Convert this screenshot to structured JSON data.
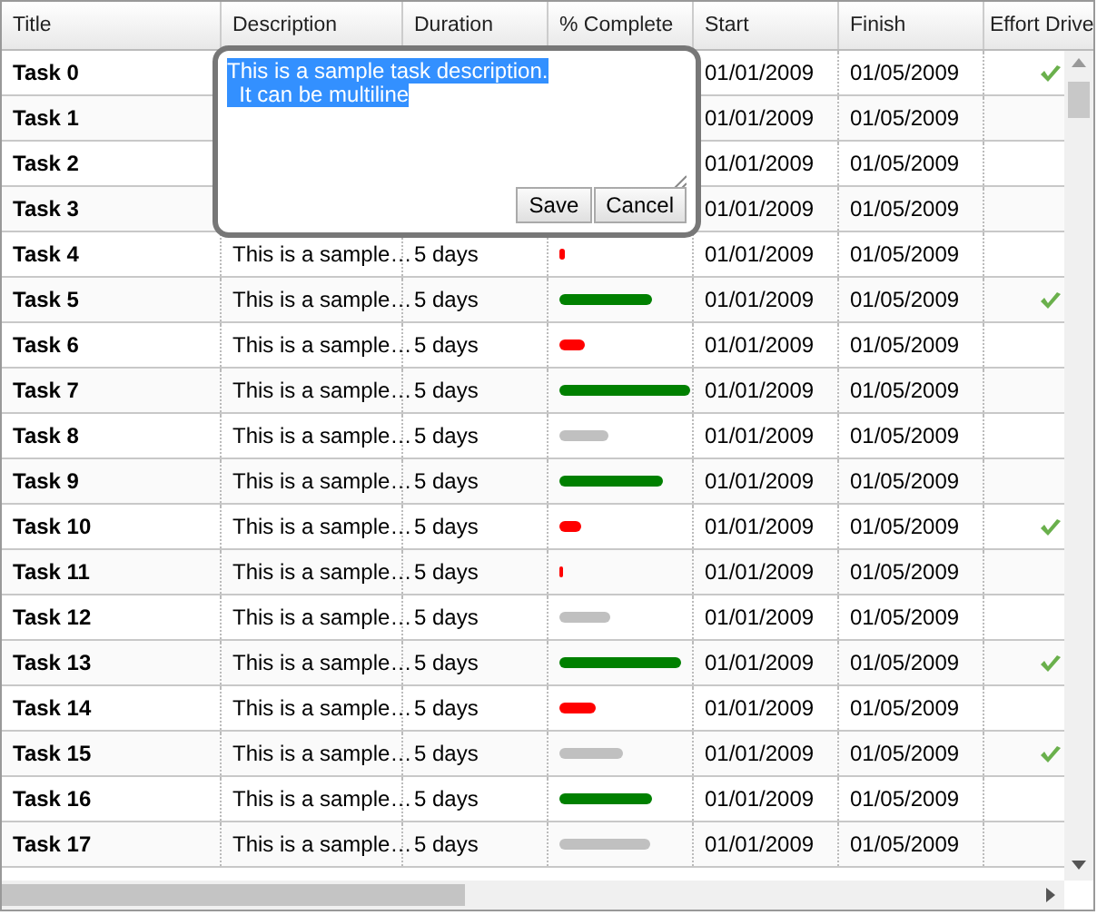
{
  "columns": [
    "Title",
    "Description",
    "Duration",
    "% Complete",
    "Start",
    "Finish",
    "Effort Drive"
  ],
  "rows": [
    {
      "title": "Task 0",
      "start": "01/01/2009",
      "finish": "01/05/2009",
      "effort_driven": true
    },
    {
      "title": "Task 1",
      "start": "01/01/2009",
      "finish": "01/05/2009",
      "effort_driven": false
    },
    {
      "title": "Task 2",
      "start": "01/01/2009",
      "finish": "01/05/2009",
      "effort_driven": false
    },
    {
      "title": "Task 3",
      "start": "01/01/2009",
      "finish": "01/05/2009",
      "effort_driven": false
    },
    {
      "title": "Task 4",
      "description": "This is a sample…",
      "duration": "5 days",
      "level": 0.04,
      "start": "01/01/2009",
      "finish": "01/05/2009",
      "effort_driven": false
    },
    {
      "title": "Task 5",
      "description": "This is a sample…",
      "duration": "5 days",
      "level": 0.71,
      "start": "01/01/2009",
      "finish": "01/05/2009",
      "effort_driven": true
    },
    {
      "title": "Task 6",
      "description": "This is a sample…",
      "duration": "5 days",
      "level": 0.2,
      "start": "01/01/2009",
      "finish": "01/05/2009",
      "effort_driven": false
    },
    {
      "title": "Task 7",
      "description": "This is a sample…",
      "duration": "5 days",
      "level": 1.0,
      "start": "01/01/2009",
      "finish": "01/05/2009",
      "effort_driven": false
    },
    {
      "title": "Task 8",
      "description": "This is a sample…",
      "duration": "5 days",
      "level": 0.37,
      "start": "01/01/2009",
      "finish": "01/05/2009",
      "effort_driven": false
    },
    {
      "title": "Task 9",
      "description": "This is a sample…",
      "duration": "5 days",
      "level": 0.79,
      "start": "01/01/2009",
      "finish": "01/05/2009",
      "effort_driven": false
    },
    {
      "title": "Task 10",
      "description": "This is a sample…",
      "duration": "5 days",
      "level": 0.16,
      "start": "01/01/2009",
      "finish": "01/05/2009",
      "effort_driven": true
    },
    {
      "title": "Task 11",
      "description": "This is a sample…",
      "duration": "5 days",
      "level": 0.02,
      "start": "01/01/2009",
      "finish": "01/05/2009",
      "effort_driven": false
    },
    {
      "title": "Task 12",
      "description": "This is a sample…",
      "duration": "5 days",
      "level": 0.39,
      "start": "01/01/2009",
      "finish": "01/05/2009",
      "effort_driven": false
    },
    {
      "title": "Task 13",
      "description": "This is a sample…",
      "duration": "5 days",
      "level": 0.93,
      "start": "01/01/2009",
      "finish": "01/05/2009",
      "effort_driven": true
    },
    {
      "title": "Task 14",
      "description": "This is a sample…",
      "duration": "5 days",
      "level": 0.28,
      "start": "01/01/2009",
      "finish": "01/05/2009",
      "effort_driven": false
    },
    {
      "title": "Task 15",
      "description": "This is a sample…",
      "duration": "5 days",
      "level": 0.49,
      "start": "01/01/2009",
      "finish": "01/05/2009",
      "effort_driven": true
    },
    {
      "title": "Task 16",
      "description": "This is a sample…",
      "duration": "5 days",
      "level": 0.71,
      "start": "01/01/2009",
      "finish": "01/05/2009",
      "effort_driven": false
    },
    {
      "title": "Task 17",
      "description": "This is a sample…",
      "duration": "5 days",
      "level": 0.69,
      "start": "01/01/2009",
      "finish": "01/05/2009",
      "effort_driven": false
    }
  ],
  "editor": {
    "lines": [
      "This is a sample task description.",
      "  It can be multiline"
    ],
    "buttons": [
      "Save",
      "Cancel"
    ]
  }
}
